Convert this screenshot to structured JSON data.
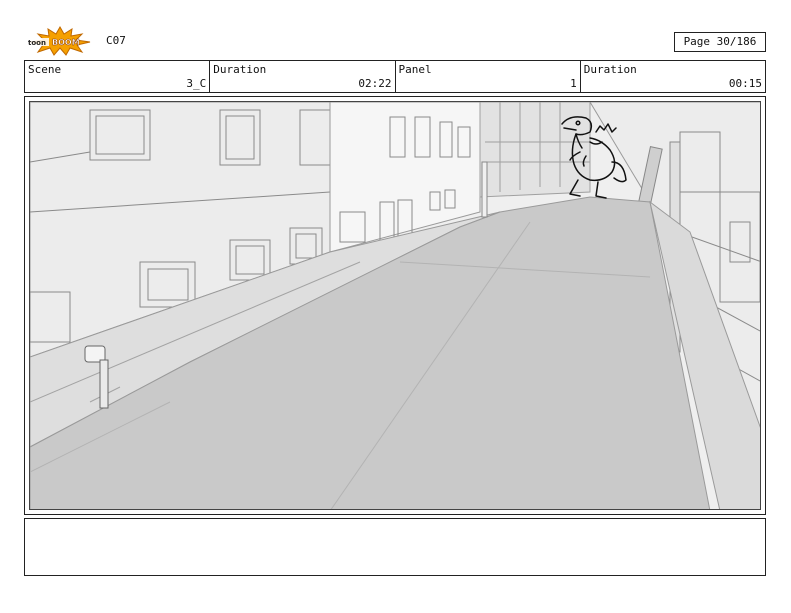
{
  "header": {
    "logo_text": "toonBOOM",
    "episode": "C07",
    "page": "Page  30/186"
  },
  "info": {
    "scene_label": "Scene",
    "scene_value": "3_C",
    "scene_duration_label": "Duration",
    "scene_duration_value": "02:22",
    "panel_label": "Panel",
    "panel_value": "1",
    "panel_duration_label": "Duration",
    "panel_duration_value": "00:15"
  },
  "panel": {
    "content": "3D city street layout with dinosaur sketch",
    "colors": {
      "road": "#c9c9c9",
      "sidewalk": "#dedede",
      "buildings": "#ececec",
      "lines": "#9a9a9a"
    }
  },
  "notes": {
    "text": ""
  }
}
